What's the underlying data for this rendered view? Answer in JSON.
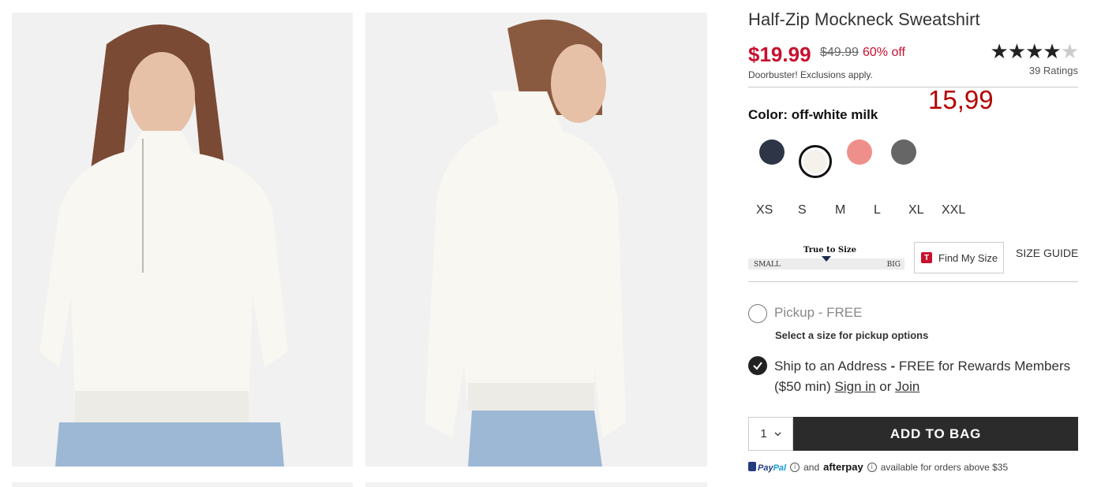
{
  "product": {
    "title": "Half-Zip Mockneck Sweatshirt",
    "sale_price": "$19.99",
    "original_price": "$49.99",
    "discount": "60% off",
    "promo_note": "Doorbuster! Exclusions apply.",
    "rating_stars": "★★★★",
    "rating_empty_star": "★",
    "rating_value": 4,
    "rating_count": "39 Ratings"
  },
  "annotation": {
    "text": "15,99",
    "color": "#b50000"
  },
  "color": {
    "label": "Color: off-white milk",
    "swatches": [
      {
        "name": "navy",
        "hex": "#2e3546",
        "selected": false
      },
      {
        "name": "off-white milk",
        "hex": "#f4f2ea",
        "selected": true
      },
      {
        "name": "pink",
        "hex": "#ef8f8c",
        "selected": false
      },
      {
        "name": "grey",
        "hex": "#666666",
        "selected": false
      }
    ]
  },
  "sizes": [
    "XS",
    "S",
    "M",
    "L",
    "XL",
    "XXL"
  ],
  "fit": {
    "label": "True to Size",
    "small": "SMALL",
    "big": "BIG"
  },
  "find_my_size": {
    "icon": "T",
    "label": "Find My Size"
  },
  "size_guide": "SIZE GUIDE",
  "fulfillment": {
    "pickup_label": "Pickup",
    "pickup_price": "- FREE",
    "pickup_note": "Select a size for pickup options",
    "ship_text": "Ship to an Address",
    "ship_dash": " - ",
    "ship_free": "FREE for Rewards Members ($50 min)",
    "sign_in": "Sign in",
    "or": "or",
    "join": "Join"
  },
  "cart": {
    "quantity": "1",
    "add_to_bag": "ADD TO BAG"
  },
  "payment": {
    "paypal_pay": "Pay",
    "paypal_pal": "Pal",
    "and": "and",
    "afterpay": "afterpay",
    "note": "available for orders above $35"
  },
  "colors": {
    "sale_red": "#c8102e",
    "button_dark": "#2b2b2b"
  }
}
